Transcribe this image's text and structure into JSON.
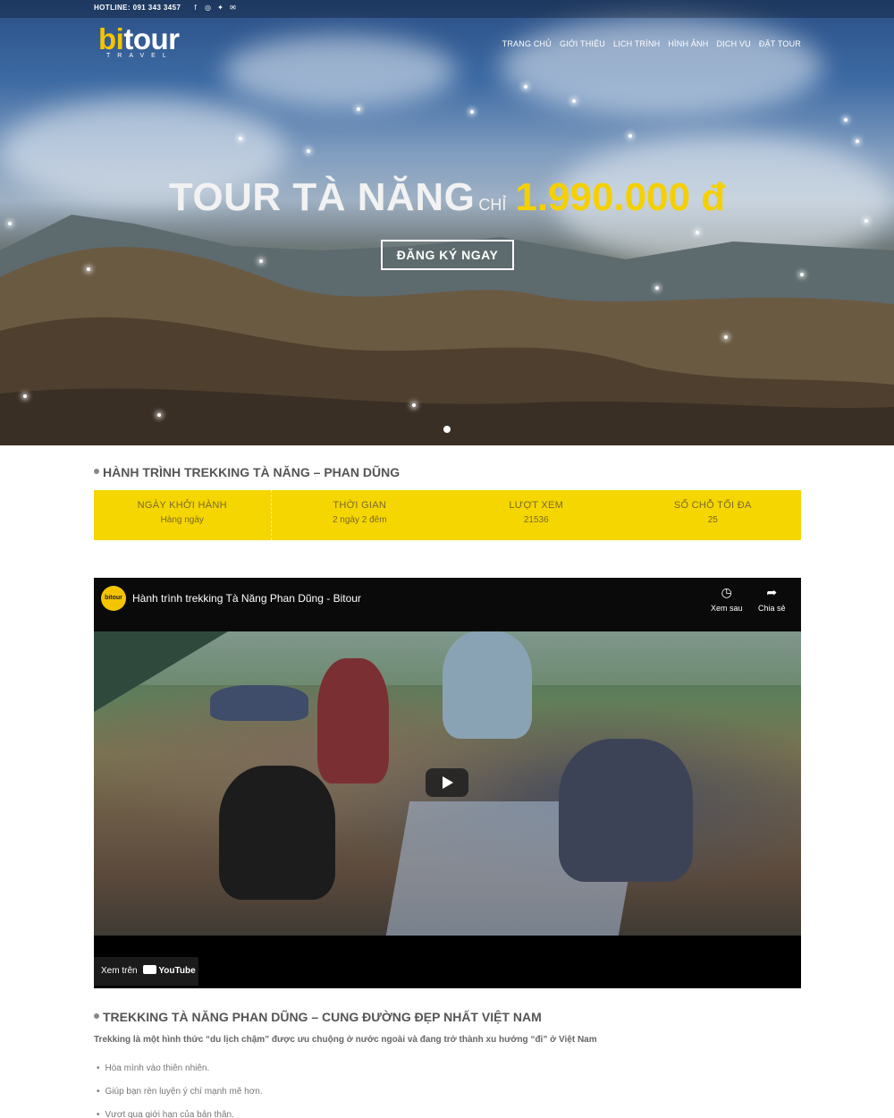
{
  "topbar": {
    "hotline": "HOTLINE: 091 343 3457",
    "social_icons": [
      "facebook-icon",
      "instagram-icon",
      "twitter-icon",
      "email-icon"
    ]
  },
  "logo": {
    "main_bi": "bi",
    "main_tour": "tour",
    "sub": "TRAVEL"
  },
  "nav": {
    "items": [
      "TRANG CHỦ",
      "GIỚI THIỆU",
      "LỊCH TRÌNH",
      "HÌNH ẢNH",
      "DỊCH VỤ",
      "ĐẶT TOUR"
    ]
  },
  "hero": {
    "title": "TOUR TÀ NĂNG",
    "price_prefix": "CHỈ",
    "price": "1.990.000 đ",
    "cta": "ĐĂNG KÝ NGAY"
  },
  "trip": {
    "title": "HÀNH TRÌNH TREKKING TÀ NĂNG – PHAN DŨNG",
    "info": [
      {
        "label": "NGÀY KHỞI HÀNH",
        "value": "Hàng ngày"
      },
      {
        "label": "THỜI GIAN",
        "value": "2 ngày 2 đêm"
      },
      {
        "label": "LƯỢT XEM",
        "value": "21536"
      },
      {
        "label": "SỐ CHỖ TỐI ĐA",
        "value": "25"
      }
    ]
  },
  "video": {
    "channel": "bitour",
    "title": "Hành trình trekking Tà Năng Phan Dũng - Bitour",
    "watch_later": "Xem sau",
    "share": "Chia sẻ",
    "watch_on": "Xem trên",
    "youtube": "YouTube"
  },
  "article": {
    "title": "TREKKING TÀ NĂNG PHAN DŨNG – CUNG ĐƯỜNG ĐẸP NHẤT VIỆT NAM",
    "intro": "Trekking là một hình thức “du lịch chậm” được ưu chuộng ở nước ngoài và đang trở thành xu hướng “đi” ở Việt Nam",
    "bullets": [
      "Hòa mình vào thiên nhiên.",
      "Giúp bạn rèn luyện ý chí mạnh mẽ hơn.",
      "Vượt qua giới hạn của bản thân."
    ]
  },
  "colors": {
    "accent": "#f5d600",
    "brand": "#f5c400"
  }
}
